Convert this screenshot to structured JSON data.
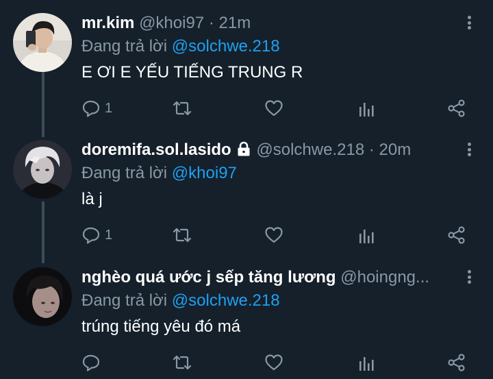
{
  "reply_prefix": "Đang trả lời",
  "tweets": [
    {
      "name": "mr.kim",
      "handle": "@khoi97",
      "separator": "·",
      "time": "21m",
      "reply_to": "@solchwe.218",
      "text": "E ƠI E YẾU TIẾNG TRUNG R",
      "reply_count": "1",
      "locked": false
    },
    {
      "name": "doremifa.sol.lasido",
      "handle": "@solchwe.218",
      "separator": "·",
      "time": "20m",
      "reply_to": "@khoi97",
      "text": "là j",
      "reply_count": "1",
      "locked": true
    },
    {
      "name": "nghèo quá ước j sếp tăng lương",
      "handle": "@hoingng...",
      "separator": "",
      "time": "",
      "reply_to": "@solchwe.218",
      "text": "trúng tiếng yêu đó má",
      "reply_count": "",
      "locked": false
    }
  ],
  "colors": {
    "background": "#15202b",
    "text_primary": "#ffffff",
    "text_secondary": "#8899a6",
    "link": "#1da1f2",
    "thread_line": "#3d4b58"
  },
  "icons": {
    "reply": "reply-bubble-icon",
    "retweet": "retweet-icon",
    "like": "heart-icon",
    "analytics": "analytics-bars-icon",
    "share": "share-icon",
    "more": "more-vertical-icon",
    "lock": "lock-icon"
  }
}
